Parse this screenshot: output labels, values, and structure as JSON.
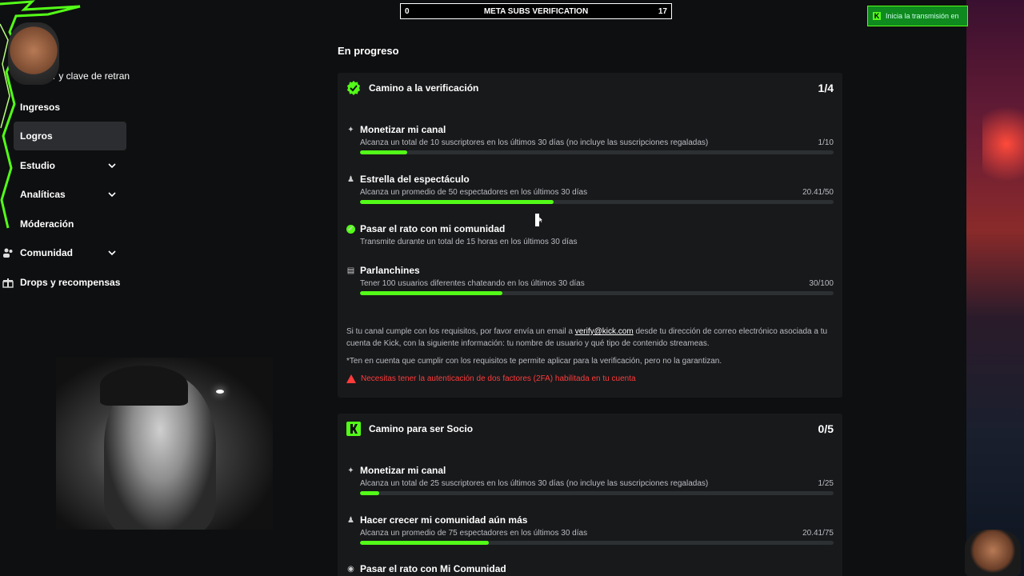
{
  "banner": {
    "left": "0",
    "title": "META SUBS VERIFICATION",
    "right": "17"
  },
  "notification": {
    "text": "Inicia la transmisión en"
  },
  "sidebar": {
    "cut_label": "vidor y clave de retran",
    "items": [
      {
        "label": "Ingresos",
        "icon": "none"
      },
      {
        "label": "Logros",
        "icon": "none",
        "active": true
      },
      {
        "label": "Estudio",
        "icon": "none",
        "chevron": true
      },
      {
        "label": "Analíticas",
        "icon": "none",
        "chevron": true
      },
      {
        "label": "Móderación",
        "icon": "shield-icon"
      },
      {
        "label": "Comunidad",
        "icon": "users-icon",
        "chevron": true
      },
      {
        "label": "Drops y recompensas",
        "icon": "gift-icon"
      }
    ]
  },
  "main": {
    "section_title": "En progreso",
    "verification": {
      "title": "Camino a la verificación",
      "count": "1/4",
      "tasks": [
        {
          "title": "Monetizar mi canal",
          "desc": "Alcanza un total de 10 suscriptores en los últimos 30 días (no incluye las suscripciones regaladas)",
          "value": "1/10",
          "progress": 0.1,
          "icon": "sparkle-icon"
        },
        {
          "title": "Estrella del espectáculo",
          "desc": "Alcanza un promedio de 50 espectadores en los últimos 30 días",
          "value": "20.41/50",
          "progress": 0.408,
          "icon": "audience-icon"
        },
        {
          "title": "Pasar el rato con mi comunidad",
          "desc": "Transmite durante un total de 15 horas en los últimos 30 días",
          "value": "",
          "progress": null,
          "icon": "check-icon"
        },
        {
          "title": "Parlanchines",
          "desc": "Tener 100 usuarios diferentes chateando en los últimos 30 días",
          "value": "30/100",
          "progress": 0.3,
          "icon": "chat-icon"
        }
      ],
      "note_pre": "Si tu canal cumple con los requisitos, por favor envía un email a",
      "note_email": "verify@kick.com",
      "note_post": "desde tu dirección de correo electrónico asociada a tu cuenta de Kick, con la siguiente información: tu nombre de usuario y qué tipo de contenido streameas.",
      "disclaimer": "*Ten en cuenta que cumplir con los requisitos te permite aplicar para la verificación, pero no la garantizan.",
      "warning": "Necesitas tener la autenticación de dos factores (2FA) habilitada en tu cuenta"
    },
    "partner": {
      "title": "Camino para ser Socio",
      "count": "0/5",
      "tasks": [
        {
          "title": "Monetizar mi canal",
          "desc": "Alcanza un total de 25 suscriptores en los últimos 30 días (no incluye las suscripciones regaladas)",
          "value": "1/25",
          "progress": 0.04,
          "icon": "sparkle-icon"
        },
        {
          "title": "Hacer crecer mi comunidad aún más",
          "desc": "Alcanza un promedio de 75 espectadores en los últimos 30 días",
          "value": "20.41/75",
          "progress": 0.272,
          "icon": "audience-icon"
        },
        {
          "title": "Pasar el rato con Mi Comunidad",
          "desc": "",
          "value": "",
          "progress": null,
          "icon": "broadcast-icon"
        }
      ]
    }
  },
  "colors": {
    "accent": "#53fc18",
    "warning": "#ff3b3b",
    "card": "#18191b",
    "bg": "#0e0f10"
  }
}
